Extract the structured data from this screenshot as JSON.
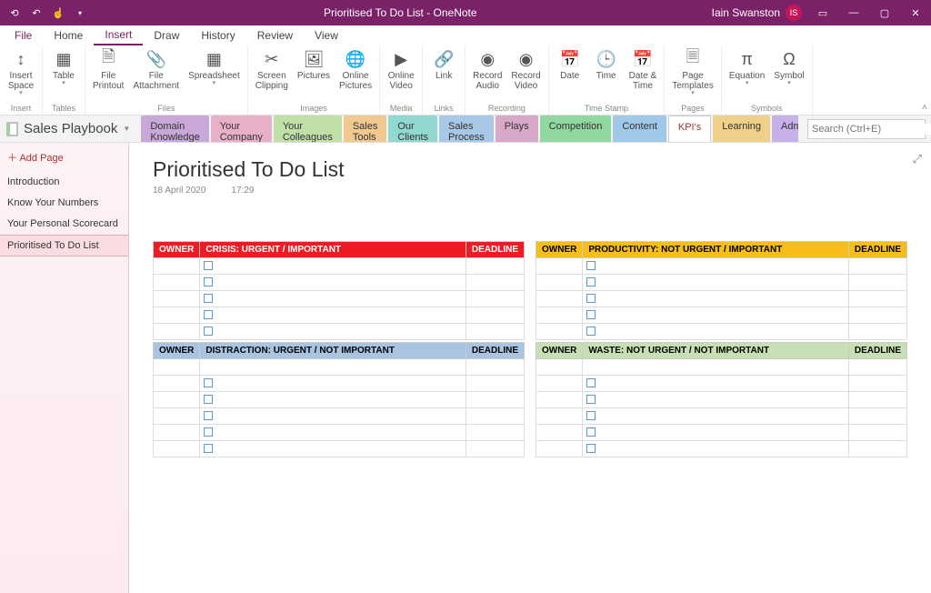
{
  "titlebar": {
    "title": "Prioritised To Do List  -  OneNote",
    "user": "Iain Swanston",
    "avatar": "IS"
  },
  "menu": {
    "items": [
      "File",
      "Home",
      "Insert",
      "Draw",
      "History",
      "Review",
      "View"
    ],
    "active": "Insert"
  },
  "ribbon": {
    "groups": [
      {
        "label": "Insert",
        "buttons": [
          {
            "icon": "↕",
            "label": "Insert\nSpace",
            "dd": true
          }
        ]
      },
      {
        "label": "Tables",
        "buttons": [
          {
            "icon": "▦",
            "label": "Table",
            "dd": true
          }
        ]
      },
      {
        "label": "Files",
        "buttons": [
          {
            "icon": "🗎",
            "label": "File\nPrintout"
          },
          {
            "icon": "📎",
            "label": "File\nAttachment"
          },
          {
            "icon": "▦",
            "label": "Spreadsheet",
            "dd": true
          }
        ]
      },
      {
        "label": "Images",
        "buttons": [
          {
            "icon": "✂",
            "label": "Screen\nClipping"
          },
          {
            "icon": "🖼",
            "label": "Pictures"
          },
          {
            "icon": "🌐",
            "label": "Online\nPictures"
          }
        ]
      },
      {
        "label": "Media",
        "buttons": [
          {
            "icon": "▶",
            "label": "Online\nVideo"
          }
        ]
      },
      {
        "label": "Links",
        "buttons": [
          {
            "icon": "🔗",
            "label": "Link"
          }
        ]
      },
      {
        "label": "Recording",
        "buttons": [
          {
            "icon": "◉",
            "label": "Record\nAudio"
          },
          {
            "icon": "◉",
            "label": "Record\nVideo"
          }
        ]
      },
      {
        "label": "Time Stamp",
        "buttons": [
          {
            "icon": "📅",
            "label": "Date"
          },
          {
            "icon": "🕒",
            "label": "Time"
          },
          {
            "icon": "📅",
            "label": "Date &\nTime"
          }
        ]
      },
      {
        "label": "Pages",
        "buttons": [
          {
            "icon": "🗏",
            "label": "Page\nTemplates",
            "dd": true
          }
        ]
      },
      {
        "label": "Symbols",
        "buttons": [
          {
            "icon": "π",
            "label": "Equation",
            "dd": true
          },
          {
            "icon": "Ω",
            "label": "Symbol",
            "dd": true
          }
        ]
      }
    ]
  },
  "notebook": {
    "name": "Sales Playbook",
    "sections": [
      {
        "label": "Domain Knowledge",
        "color": "#c8a8d8"
      },
      {
        "label": "Your Company",
        "color": "#e8b0c8"
      },
      {
        "label": "Your Colleagues",
        "color": "#c0e0a8"
      },
      {
        "label": "Sales Tools",
        "color": "#f0c890"
      },
      {
        "label": "Our Clients",
        "color": "#90d8d0"
      },
      {
        "label": "Sales Process",
        "color": "#a8c8e8"
      },
      {
        "label": "Plays",
        "color": "#d8a8c8"
      },
      {
        "label": "Competition",
        "color": "#90d8a0"
      },
      {
        "label": "Content",
        "color": "#a0c8e8"
      },
      {
        "label": "KPI's",
        "color": "#f8e8e8",
        "active": true
      },
      {
        "label": "Learning",
        "color": "#f0d088"
      },
      {
        "label": "Admin",
        "color": "#c8b0e8"
      }
    ],
    "search_placeholder": "Search (Ctrl+E)"
  },
  "pages": {
    "add_label": "Add Page",
    "items": [
      "Introduction",
      "Know Your Numbers",
      "Your Personal Scorecard",
      "Prioritised To Do List"
    ],
    "selected": 3
  },
  "page": {
    "title": "Prioritised To Do List",
    "date": "18 April 2020",
    "time": "17:29"
  },
  "quadrants": {
    "owner_hdr": "OWNER",
    "deadline_hdr": "DEADLINE",
    "q1": {
      "title": "CRISIS: URGENT / IMPORTANT",
      "rows": 5
    },
    "q2": {
      "title": "PRODUCTIVITY: NOT URGENT / IMPORTANT",
      "rows": 5
    },
    "q3": {
      "title": "DISTRACTION: URGENT / NOT IMPORTANT",
      "rows": 5
    },
    "q4": {
      "title": "WASTE: NOT URGENT / NOT IMPORTANT",
      "rows": 5
    }
  }
}
